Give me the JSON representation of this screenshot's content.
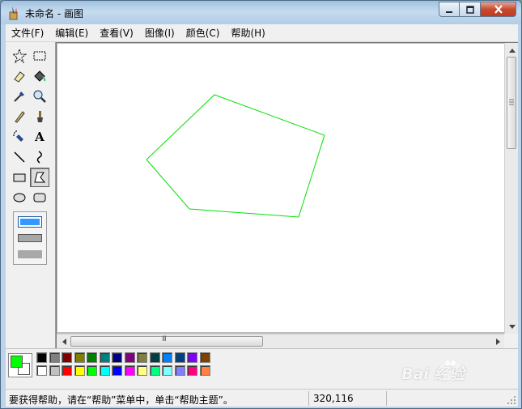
{
  "window": {
    "title": "未命名 - 画图",
    "buttons": {
      "minimize": "minimize",
      "maximize": "maximize",
      "close": "close"
    }
  },
  "menubar": {
    "items": [
      "文件(F)",
      "编辑(E)",
      "查看(V)",
      "图像(I)",
      "颜色(C)",
      "帮助(H)"
    ]
  },
  "toolbox": {
    "tools": [
      {
        "name": "free-form-select-tool",
        "icon": "star-select-icon"
      },
      {
        "name": "rect-select-tool",
        "icon": "dashed-rect-icon"
      },
      {
        "name": "eraser-tool",
        "icon": "eraser-icon"
      },
      {
        "name": "fill-tool",
        "icon": "paint-bucket-icon"
      },
      {
        "name": "color-picker-tool",
        "icon": "eyedropper-icon"
      },
      {
        "name": "magnifier-tool",
        "icon": "magnifier-icon"
      },
      {
        "name": "pencil-tool",
        "icon": "pencil-icon"
      },
      {
        "name": "brush-tool",
        "icon": "brush-icon"
      },
      {
        "name": "airbrush-tool",
        "icon": "airbrush-icon"
      },
      {
        "name": "text-tool",
        "icon": "text-icon"
      },
      {
        "name": "line-tool",
        "icon": "line-icon"
      },
      {
        "name": "curve-tool",
        "icon": "curve-icon"
      },
      {
        "name": "rectangle-tool",
        "icon": "rectangle-icon"
      },
      {
        "name": "polygon-tool",
        "icon": "polygon-icon",
        "active": true
      },
      {
        "name": "ellipse-tool",
        "icon": "ellipse-icon"
      },
      {
        "name": "rounded-rect-tool",
        "icon": "rounded-rect-icon"
      }
    ],
    "text_tool_glyph": "A"
  },
  "canvas": {
    "shape": "polygon",
    "stroke_color": "#00e000",
    "scrollbar_grip": "III"
  },
  "palette": {
    "foreground": "#00ff00",
    "background": "#ffffff",
    "row1": [
      "#000000",
      "#808080",
      "#800000",
      "#808000",
      "#008000",
      "#008080",
      "#000080",
      "#800080",
      "#808040",
      "#004040",
      "#0080ff",
      "#004080",
      "#8000ff",
      "#804000"
    ],
    "row2": [
      "#ffffff",
      "#c0c0c0",
      "#ff0000",
      "#ffff00",
      "#00ff00",
      "#00ffff",
      "#0000ff",
      "#ff00ff",
      "#ffff80",
      "#00ff80",
      "#80ffff",
      "#8080ff",
      "#ff0080",
      "#ff8040"
    ]
  },
  "statusbar": {
    "help_text": "要获得帮助，请在“帮助”菜单中，单击“帮助主题”。",
    "coordinates": "320,116"
  },
  "watermark": {
    "text": "Bai 经验"
  }
}
